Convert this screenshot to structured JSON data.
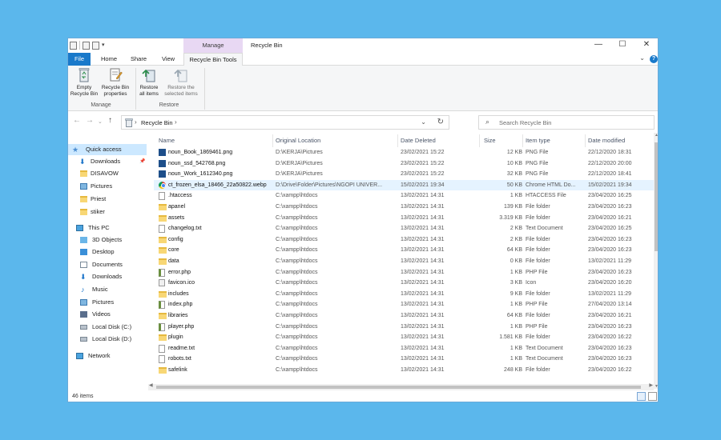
{
  "window": {
    "title": "Recycle Bin",
    "manage_label": "Manage",
    "controls": {
      "minimize": "—",
      "maximize": "☐",
      "close": "✕"
    }
  },
  "ribbon_tabs": [
    "File",
    "Home",
    "Share",
    "View",
    "Recycle Bin Tools"
  ],
  "ribbon": {
    "empty_line1": "Empty",
    "empty_line2": "Recycle Bin",
    "props_line1": "Recycle Bin",
    "props_line2": "properties",
    "restore_all_line1": "Restore",
    "restore_all_line2": "all items",
    "restore_sel_line1": "Restore the",
    "restore_sel_line2": "selected items",
    "group_manage": "Manage",
    "group_restore": "Restore"
  },
  "address": {
    "crumb": "Recycle Bin",
    "search_placeholder": "Search Recycle Bin"
  },
  "nav": {
    "quick_access": "Quick access",
    "pinned": [
      "Downloads",
      "DISAVOW",
      "Pictures",
      "Priest",
      "stiker"
    ],
    "this_pc": "This PC",
    "pc_items": [
      "3D Objects",
      "Desktop",
      "Documents",
      "Downloads",
      "Music",
      "Pictures",
      "Videos",
      "Local Disk (C:)",
      "Local Disk (D:)"
    ],
    "network": "Network"
  },
  "columns": {
    "name": "Name",
    "original_location": "Original Location",
    "date_deleted": "Date Deleted",
    "size": "Size",
    "item_type": "Item type",
    "date_modified": "Date modified"
  },
  "files": [
    {
      "icon": "png",
      "name": "noun_Book_1869461.png",
      "loc": "D:\\KERJA\\Pictures",
      "deleted": "23/02/2021 15:22",
      "size": "12 KB",
      "type": "PNG File",
      "modified": "22/12/2020 18:31"
    },
    {
      "icon": "png",
      "name": "noun_ssd_542768.png",
      "loc": "D:\\KERJA\\Pictures",
      "deleted": "23/02/2021 15:22",
      "size": "10 KB",
      "type": "PNG File",
      "modified": "22/12/2020 20:00"
    },
    {
      "icon": "png",
      "name": "noun_Work_1612340.png",
      "loc": "D:\\KERJA\\Pictures",
      "deleted": "23/02/2021 15:22",
      "size": "32 KB",
      "type": "PNG File",
      "modified": "22/12/2020 18:41"
    },
    {
      "icon": "chrome",
      "name": "ct_frozen_elsa_18466_22a50822.webp",
      "loc": "D:\\Drive\\Folder\\Pictures\\NGOPI UNIVER...",
      "deleted": "15/02/2021 19:34",
      "size": "50 KB",
      "type": "Chrome HTML Do...",
      "modified": "15/02/2021 19:34"
    },
    {
      "icon": "doc",
      "name": ".htaccess",
      "loc": "C:\\xampp\\htdocs",
      "deleted": "13/02/2021 14:31",
      "size": "1 KB",
      "type": "HTACCESS File",
      "modified": "23/04/2020 16:25"
    },
    {
      "icon": "folder",
      "name": "apanel",
      "loc": "C:\\xampp\\htdocs",
      "deleted": "13/02/2021 14:31",
      "size": "139 KB",
      "type": "File folder",
      "modified": "23/04/2020 16:23"
    },
    {
      "icon": "folder",
      "name": "assets",
      "loc": "C:\\xampp\\htdocs",
      "deleted": "13/02/2021 14:31",
      "size": "3.319 KB",
      "type": "File folder",
      "modified": "23/04/2020 16:21"
    },
    {
      "icon": "doc",
      "name": "changelog.txt",
      "loc": "C:\\xampp\\htdocs",
      "deleted": "13/02/2021 14:31",
      "size": "2 KB",
      "type": "Text Document",
      "modified": "23/04/2020 16:25"
    },
    {
      "icon": "folder",
      "name": "config",
      "loc": "C:\\xampp\\htdocs",
      "deleted": "13/02/2021 14:31",
      "size": "2 KB",
      "type": "File folder",
      "modified": "23/04/2020 16:23"
    },
    {
      "icon": "folder",
      "name": "core",
      "loc": "C:\\xampp\\htdocs",
      "deleted": "13/02/2021 14:31",
      "size": "64 KB",
      "type": "File folder",
      "modified": "23/04/2020 16:23"
    },
    {
      "icon": "folder",
      "name": "data",
      "loc": "C:\\xampp\\htdocs",
      "deleted": "13/02/2021 14:31",
      "size": "0 KB",
      "type": "File folder",
      "modified": "13/02/2021 11:29"
    },
    {
      "icon": "php",
      "name": "error.php",
      "loc": "C:\\xampp\\htdocs",
      "deleted": "13/02/2021 14:31",
      "size": "1 KB",
      "type": "PHP File",
      "modified": "23/04/2020 16:23"
    },
    {
      "icon": "ico",
      "name": "favicon.ico",
      "loc": "C:\\xampp\\htdocs",
      "deleted": "13/02/2021 14:31",
      "size": "3 KB",
      "type": "Icon",
      "modified": "23/04/2020 16:20"
    },
    {
      "icon": "folder",
      "name": "includes",
      "loc": "C:\\xampp\\htdocs",
      "deleted": "13/02/2021 14:31",
      "size": "9 KB",
      "type": "File folder",
      "modified": "13/02/2021 11:29"
    },
    {
      "icon": "php",
      "name": "index.php",
      "loc": "C:\\xampp\\htdocs",
      "deleted": "13/02/2021 14:31",
      "size": "1 KB",
      "type": "PHP File",
      "modified": "27/04/2020 13:14"
    },
    {
      "icon": "folder",
      "name": "libraries",
      "loc": "C:\\xampp\\htdocs",
      "deleted": "13/02/2021 14:31",
      "size": "64 KB",
      "type": "File folder",
      "modified": "23/04/2020 16:21"
    },
    {
      "icon": "php",
      "name": "player.php",
      "loc": "C:\\xampp\\htdocs",
      "deleted": "13/02/2021 14:31",
      "size": "1 KB",
      "type": "PHP File",
      "modified": "23/04/2020 16:23"
    },
    {
      "icon": "folder",
      "name": "plugin",
      "loc": "C:\\xampp\\htdocs",
      "deleted": "13/02/2021 14:31",
      "size": "1.581 KB",
      "type": "File folder",
      "modified": "23/04/2020 16:22"
    },
    {
      "icon": "doc",
      "name": "readme.txt",
      "loc": "C:\\xampp\\htdocs",
      "deleted": "13/02/2021 14:31",
      "size": "1 KB",
      "type": "Text Document",
      "modified": "23/04/2020 16:23"
    },
    {
      "icon": "doc",
      "name": "robots.txt",
      "loc": "C:\\xampp\\htdocs",
      "deleted": "13/02/2021 14:31",
      "size": "1 KB",
      "type": "Text Document",
      "modified": "23/04/2020 16:23"
    },
    {
      "icon": "folder",
      "name": "safelink",
      "loc": "C:\\xampp\\htdocs",
      "deleted": "13/02/2021 14:31",
      "size": "248 KB",
      "type": "File folder",
      "modified": "23/04/2020 16:22"
    }
  ],
  "status": {
    "count": "46 items"
  },
  "colors": {
    "accent": "#1979ca",
    "manage_tab": "#e8d8f3",
    "selection": "#cce8ff",
    "hover_row": "#e5f3ff",
    "folder": "#f8d775"
  }
}
